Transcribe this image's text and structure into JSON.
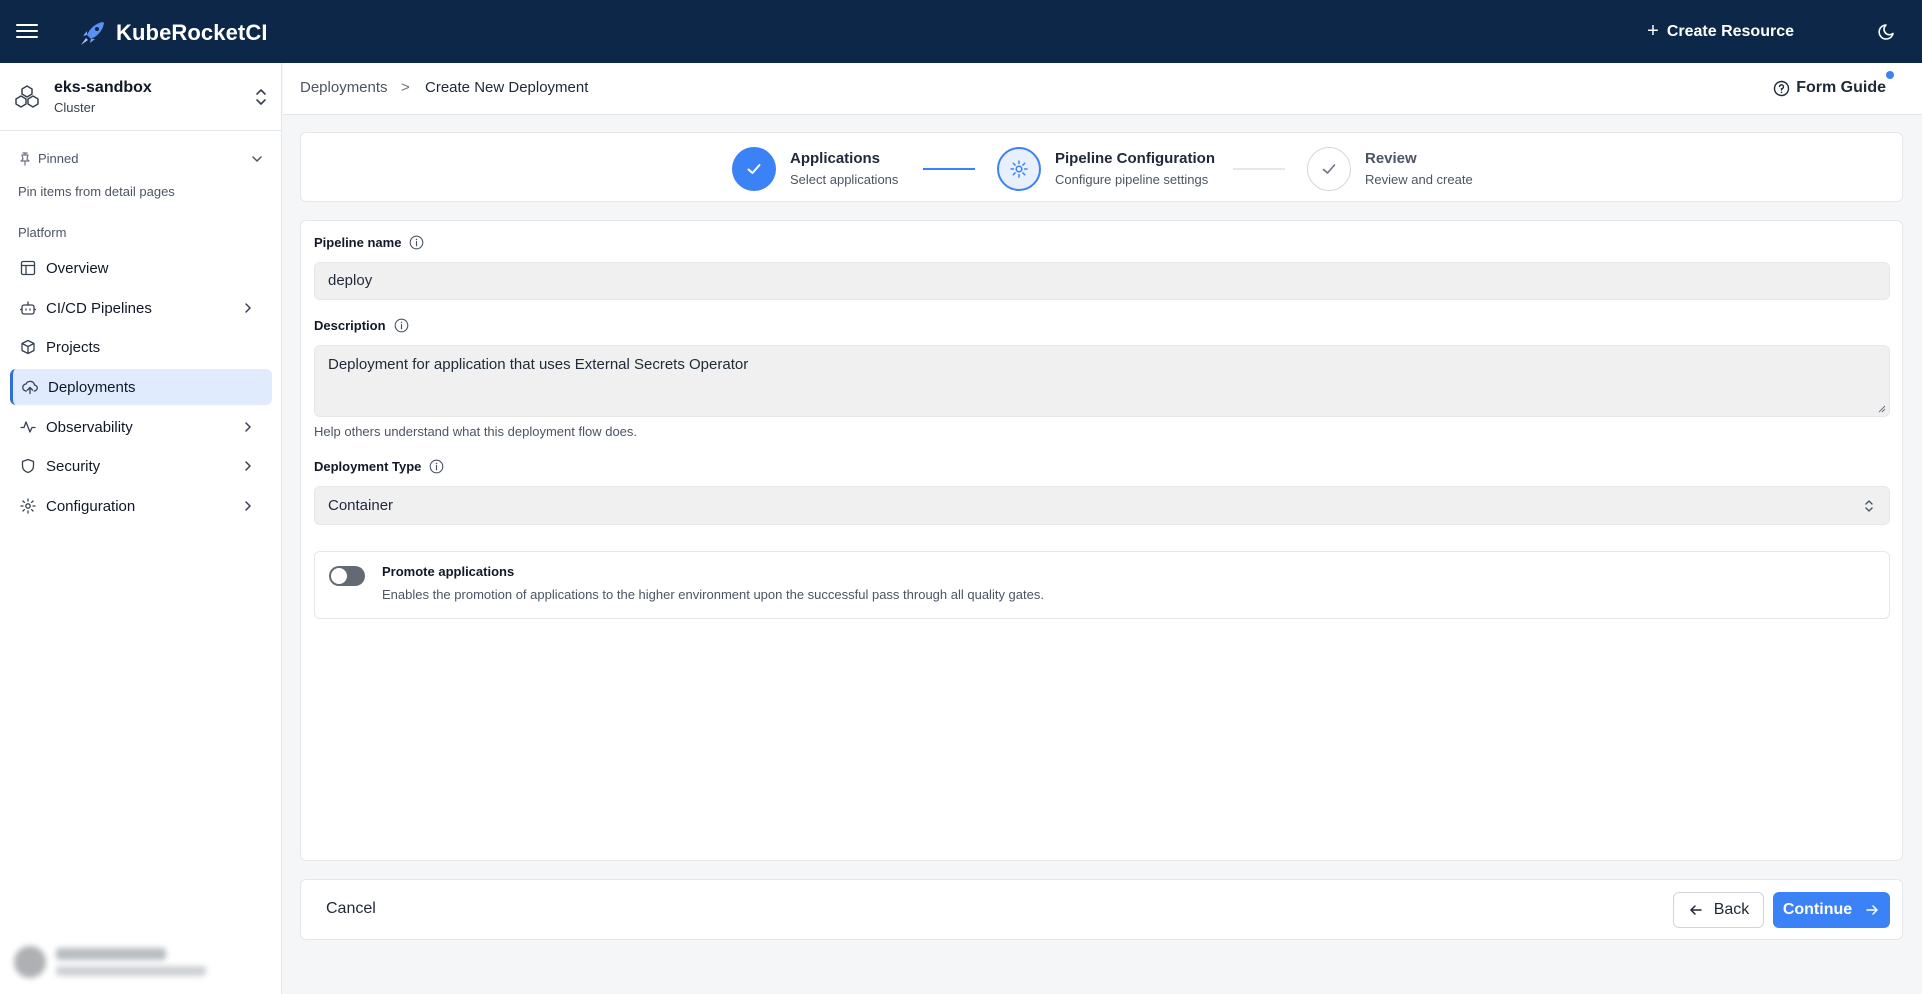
{
  "app": {
    "title": "KubeRocketCI"
  },
  "topbar": {
    "create_resource_label": "Create Resource"
  },
  "cluster": {
    "name": "eks-sandbox",
    "subtitle": "Cluster"
  },
  "sidebar": {
    "pinned_label": "Pinned",
    "pinned_hint": "Pin items from detail pages",
    "section_label": "Platform",
    "items": [
      {
        "label": "Overview",
        "icon": "layout-icon",
        "has_children": false,
        "active": false
      },
      {
        "label": "CI/CD Pipelines",
        "icon": "bot-icon",
        "has_children": true,
        "active": false
      },
      {
        "label": "Projects",
        "icon": "box-icon",
        "has_children": false,
        "active": false
      },
      {
        "label": "Deployments",
        "icon": "cloud-upload-icon",
        "has_children": false,
        "active": true
      },
      {
        "label": "Observability",
        "icon": "activity-icon",
        "has_children": true,
        "active": false
      },
      {
        "label": "Security",
        "icon": "shield-icon",
        "has_children": true,
        "active": false
      },
      {
        "label": "Configuration",
        "icon": "gear-icon",
        "has_children": true,
        "active": false
      }
    ]
  },
  "breadcrumb": {
    "parent": "Deployments",
    "separator": ">",
    "current": "Create New Deployment"
  },
  "form_guide": {
    "label": "Form Guide"
  },
  "stepper": {
    "steps": [
      {
        "title": "Applications",
        "subtitle": "Select applications",
        "state": "done"
      },
      {
        "title": "Pipeline Configuration",
        "subtitle": "Configure pipeline settings",
        "state": "current"
      },
      {
        "title": "Review",
        "subtitle": "Review and create",
        "state": "todo"
      }
    ]
  },
  "form": {
    "pipeline_name": {
      "label": "Pipeline name",
      "value": "deploy"
    },
    "description": {
      "label": "Description",
      "value": "Deployment for application that uses External Secrets Operator",
      "helper": "Help others understand what this deployment flow does."
    },
    "deployment_type": {
      "label": "Deployment Type",
      "value": "Container"
    },
    "promote": {
      "title": "Promote applications",
      "description": "Enables the promotion of applications to the higher environment upon the successful pass through all quality gates.",
      "enabled": false
    }
  },
  "footer": {
    "cancel_label": "Cancel",
    "back_label": "Back",
    "continue_label": "Continue"
  },
  "colors": {
    "topbar": "#0c2748",
    "accent": "#3b82f6",
    "active_nav_bg": "#e0ecfd"
  }
}
